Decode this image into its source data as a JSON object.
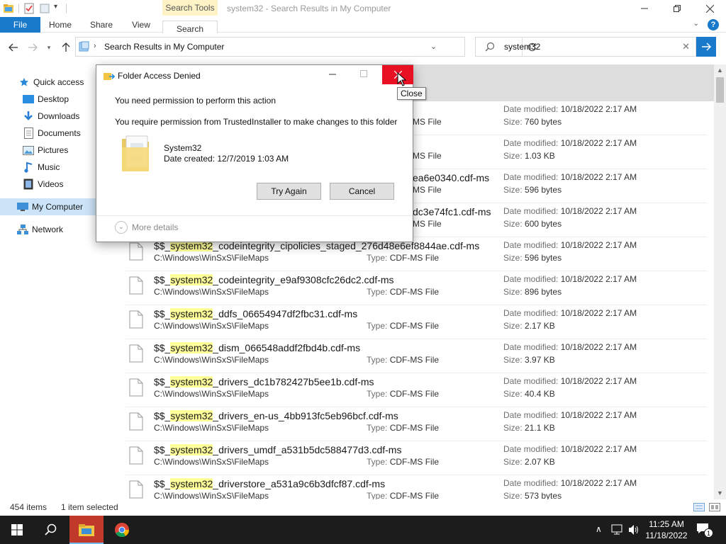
{
  "window": {
    "title": "system32 - Search Results in My Computer",
    "context_tab_label": "Search Tools"
  },
  "ribbon": {
    "tabs": [
      "File",
      "Home",
      "Share",
      "View",
      "Search"
    ]
  },
  "address": {
    "path": "Search Results in My Computer"
  },
  "search": {
    "query": "system32"
  },
  "sidebar": {
    "items": [
      {
        "label": "Quick access",
        "icon": "star-icon"
      },
      {
        "label": "Desktop",
        "icon": "desktop-icon"
      },
      {
        "label": "Downloads",
        "icon": "download-icon"
      },
      {
        "label": "Documents",
        "icon": "documents-icon"
      },
      {
        "label": "Pictures",
        "icon": "pictures-icon"
      },
      {
        "label": "Music",
        "icon": "music-icon"
      },
      {
        "label": "Videos",
        "icon": "videos-icon"
      },
      {
        "label": "My Computer",
        "icon": "computer-icon"
      },
      {
        "label": "Network",
        "icon": "network-icon"
      }
    ]
  },
  "labels": {
    "type": "Type:",
    "date_modified": "Date modified:",
    "size": "Size:"
  },
  "results": [
    {
      "prefix": "",
      "hl": "",
      "rest": "",
      "path": "",
      "type": "MS File",
      "date": "10/18/2022 2:17 AM",
      "size": "760 bytes",
      "partial": true
    },
    {
      "prefix": "",
      "hl": "",
      "rest": "",
      "path": "",
      "type": "MS File",
      "date": "10/18/2022 2:17 AM",
      "size": "1.03 KB",
      "partial": true
    },
    {
      "prefix": "",
      "hl": "",
      "rest": "ea6e0340.cdf-ms",
      "path": "",
      "type": "MS File",
      "date": "10/18/2022 2:17 AM",
      "size": "596 bytes",
      "partial": true
    },
    {
      "prefix": "",
      "hl": "",
      "rest": "dc3e74fc1.cdf-ms",
      "path": "",
      "type": "MS File",
      "date": "10/18/2022 2:17 AM",
      "size": "600 bytes",
      "partial": true
    },
    {
      "prefix": "$$_",
      "hl": "system32",
      "rest": "_codeintegrity_cipolicies_staged_276d48e6ef8844ae.cdf-ms",
      "path": "C:\\Windows\\WinSxS\\FileMaps",
      "type": "CDF-MS File",
      "date": "10/18/2022 2:17 AM",
      "size": "596 bytes",
      "partial": false
    },
    {
      "prefix": "$$_",
      "hl": "system32",
      "rest": "_codeintegrity_e9af9308cfc26dc2.cdf-ms",
      "path": "C:\\Windows\\WinSxS\\FileMaps",
      "type": "CDF-MS File",
      "date": "10/18/2022 2:17 AM",
      "size": "896 bytes",
      "partial": false
    },
    {
      "prefix": "$$_",
      "hl": "system32",
      "rest": "_ddfs_06654947df2fbc31.cdf-ms",
      "path": "C:\\Windows\\WinSxS\\FileMaps",
      "type": "CDF-MS File",
      "date": "10/18/2022 2:17 AM",
      "size": "2.17 KB",
      "partial": false
    },
    {
      "prefix": "$$_",
      "hl": "system32",
      "rest": "_dism_066548addf2fbd4b.cdf-ms",
      "path": "C:\\Windows\\WinSxS\\FileMaps",
      "type": "CDF-MS File",
      "date": "10/18/2022 2:17 AM",
      "size": "3.97 KB",
      "partial": false
    },
    {
      "prefix": "$$_",
      "hl": "system32",
      "rest": "_drivers_dc1b782427b5ee1b.cdf-ms",
      "path": "C:\\Windows\\WinSxS\\FileMaps",
      "type": "CDF-MS File",
      "date": "10/18/2022 2:17 AM",
      "size": "40.4 KB",
      "partial": false
    },
    {
      "prefix": "$$_",
      "hl": "system32",
      "rest": "_drivers_en-us_4bb913fc5eb96bcf.cdf-ms",
      "path": "C:\\Windows\\WinSxS\\FileMaps",
      "type": "CDF-MS File",
      "date": "10/18/2022 2:17 AM",
      "size": "21.1 KB",
      "partial": false
    },
    {
      "prefix": "$$_",
      "hl": "system32",
      "rest": "_drivers_umdf_a531b5dc588477d3.cdf-ms",
      "path": "C:\\Windows\\WinSxS\\FileMaps",
      "type": "CDF-MS File",
      "date": "10/18/2022 2:17 AM",
      "size": "2.07 KB",
      "partial": false
    },
    {
      "prefix": "$$_",
      "hl": "system32",
      "rest": "_driverstore_a531a9c6b3dfcf87.cdf-ms",
      "path": "C:\\Windows\\WinSxS\\FileMaps",
      "type": "CDF-MS File",
      "date": "10/18/2022 2:17 AM",
      "size": "573 bytes",
      "partial": false
    }
  ],
  "status": {
    "item_count": "454 items",
    "selected": "1 item selected"
  },
  "dialog": {
    "title": "Folder Access Denied",
    "line1": "You need permission to perform this action",
    "line2": "You require permission from TrustedInstaller to make changes to this folder",
    "folder_name": "System32",
    "folder_date": "Date created: 12/7/2019 1:03 AM",
    "try_again": "Try Again",
    "cancel": "Cancel",
    "more_details": "More details"
  },
  "tooltip": {
    "text": "Close"
  },
  "clock": {
    "time": "11:25 AM",
    "date": "11/18/2022"
  },
  "notifications": {
    "count": "1"
  },
  "colors": {
    "accent": "#1979ca",
    "highlight": "#ffff99",
    "close_red": "#e81123",
    "taskbar": "#1c1c1c"
  }
}
